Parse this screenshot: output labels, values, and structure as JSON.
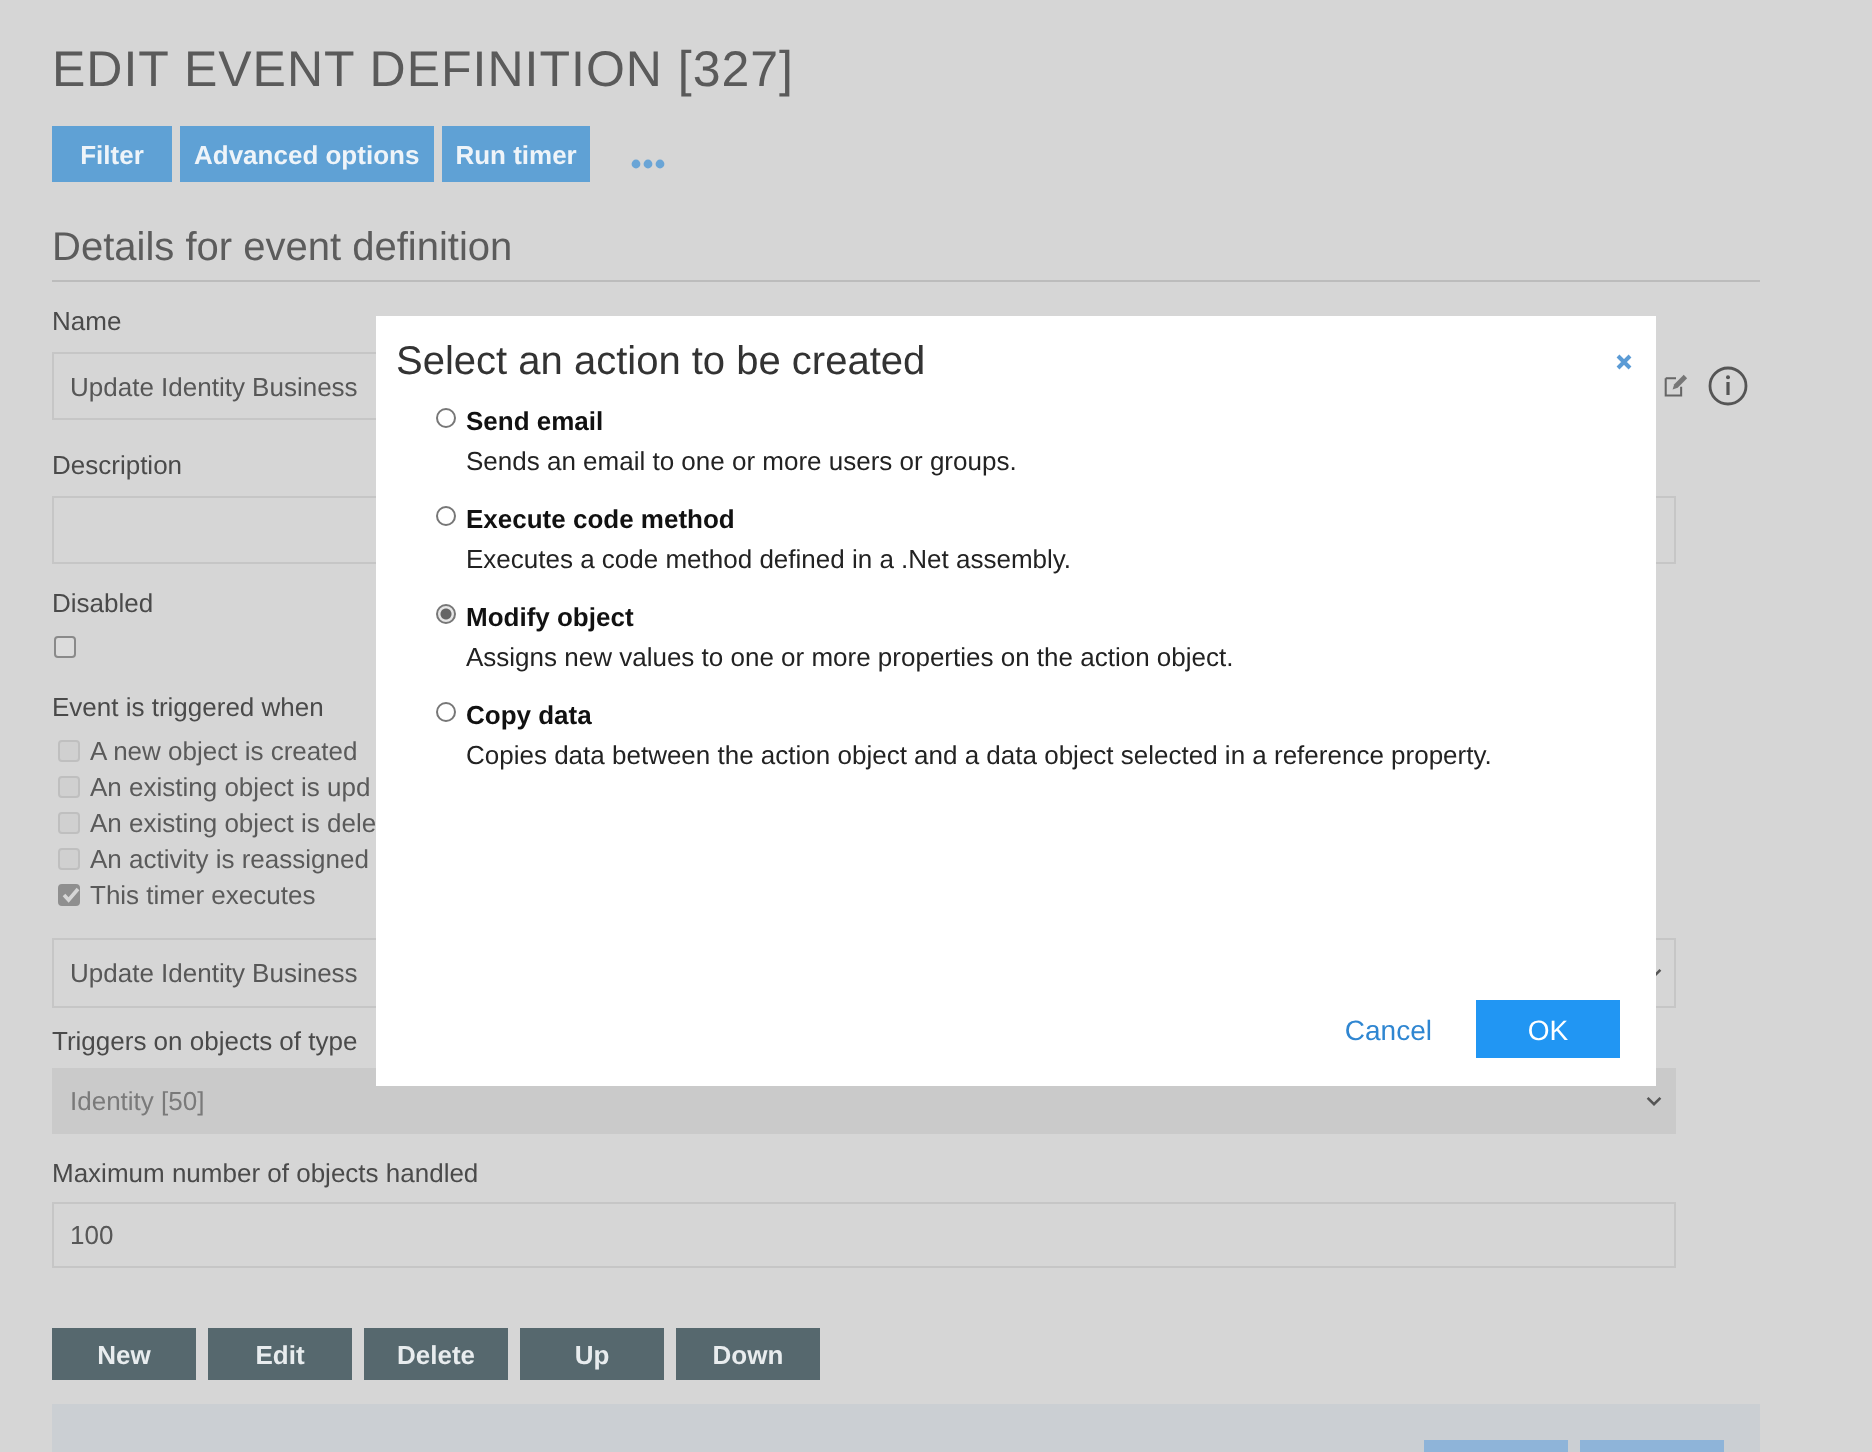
{
  "page": {
    "title": "EDIT EVENT DEFINITION [327]",
    "toolbar": [
      "Filter",
      "Advanced options",
      "Run timer"
    ],
    "section": "Details for event definition",
    "fields": [
      {
        "kind": "text",
        "label": "Name",
        "value": "Update Identity Business",
        "icons": true
      },
      {
        "kind": "textarea",
        "label": "Description"
      },
      {
        "kind": "checkbox",
        "label": "Disabled",
        "checked": false
      },
      {
        "kind": "checklist",
        "label": "Event is triggered when",
        "options": [
          {
            "label": "A new object is created",
            "checked": false
          },
          {
            "label": "An existing object is upd",
            "checked": false
          },
          {
            "label": "An existing object is dele",
            "checked": false
          },
          {
            "label": "An activity is reassigned",
            "checked": false
          },
          {
            "label": "This timer executes",
            "checked": true
          }
        ]
      },
      {
        "kind": "select",
        "value": "Update Identity Business",
        "disabled": false
      },
      {
        "kind": "select",
        "label": "Triggers on objects of type",
        "value": "Identity [50]",
        "disabled": true
      },
      {
        "kind": "text",
        "label": "Maximum number of objects handled",
        "value": "100"
      }
    ],
    "list_buttons": [
      "New",
      "Edit",
      "Delete",
      "Up",
      "Down"
    ]
  },
  "dialog": {
    "title": "Select an action to be created",
    "options": [
      {
        "label": "Send email",
        "description": "Sends an email to one or more users or groups.",
        "selected": false
      },
      {
        "label": "Execute code method",
        "description": "Executes a code method defined in a .Net assembly.",
        "selected": false
      },
      {
        "label": "Modify object",
        "description": "Assigns new values to one or more properties on the action object.",
        "selected": true
      },
      {
        "label": "Copy data",
        "description": "Copies data between the action object and a data object selected in a reference property.",
        "selected": false
      }
    ],
    "cancel": "Cancel",
    "ok": "OK"
  }
}
